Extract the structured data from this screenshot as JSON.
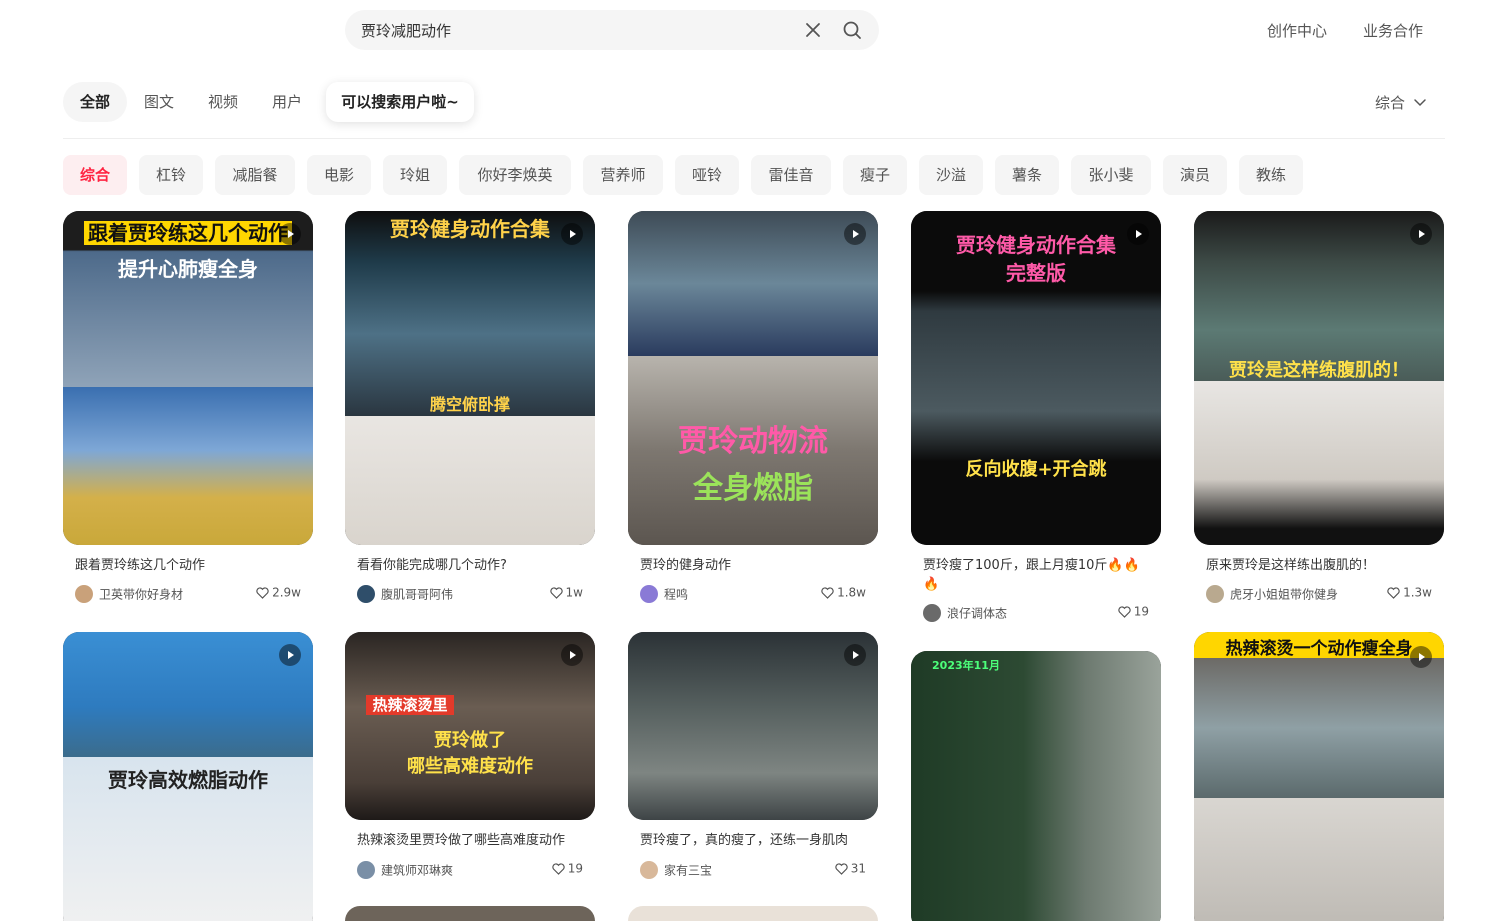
{
  "search": {
    "value": "贾玲减肥动作"
  },
  "header_links": [
    "创作中心",
    "业务合作"
  ],
  "tabs": [
    "全部",
    "图文",
    "视频",
    "用户"
  ],
  "tooltip": "可以搜索用户啦~",
  "sort": "综合",
  "chips": [
    "综合",
    "杠铃",
    "减脂餐",
    "电影",
    "玲姐",
    "你好李焕英",
    "营养师",
    "哑铃",
    "雷佳音",
    "瘦子",
    "沙溢",
    "薯条",
    "张小斐",
    "演员",
    "教练"
  ],
  "cards": [
    {
      "title": "跟着贾玲练这几个动作",
      "author": "卫英带你好身材",
      "likes": "2.9w",
      "overlay": [
        "跟着贾玲练这几个动作",
        "提升心肺瘦全身"
      ]
    },
    {
      "title": "看看你能完成哪几个动作?",
      "author": "腹肌哥哥阿伟",
      "likes": "1w",
      "overlay": [
        "贾玲健身动作合集",
        "腾空俯卧撑"
      ]
    },
    {
      "title": "贾玲的健身动作",
      "author": "程鸣",
      "likes": "1.8w",
      "overlay": [
        "贾玲动物流",
        "全身燃脂"
      ]
    },
    {
      "title": "贾玲瘦了100斤，跟上月瘦10斤🔥🔥🔥",
      "author": "浪仔调体态",
      "likes": "19",
      "overlay": [
        "贾玲健身动作合集",
        "完整版",
        "反向收腹+开合跳"
      ]
    },
    {
      "title": "原来贾玲是这样练出腹肌的！",
      "author": "虎牙小姐姐带你健身",
      "likes": "1.3w",
      "overlay": [
        "贾玲是这样练腹肌的！"
      ]
    },
    {
      "title": "",
      "author": "",
      "likes": "",
      "overlay": [
        "贾玲高效燃脂动作"
      ]
    },
    {
      "title": "热辣滚烫里贾玲做了哪些高难度动作",
      "author": "建筑师邓琳爽",
      "likes": "19",
      "overlay": [
        "热辣滚烫里",
        "贾玲做了",
        "哪些高难度动作"
      ]
    },
    {
      "title": "贾玲瘦了，真的瘦了，还练一身肌肉",
      "author": "家有三宝",
      "likes": "31",
      "overlay": []
    },
    {
      "title": "",
      "author": "",
      "likes": "",
      "overlay": [
        "2023年11月"
      ]
    },
    {
      "title": "",
      "author": "",
      "likes": "",
      "overlay": [
        "热辣滚烫一个动作瘦全身"
      ]
    }
  ],
  "colors": {
    "accent": "#ff2442",
    "chip_bg": "#f5f5f5",
    "active_chip_bg": "#fdeef0"
  }
}
